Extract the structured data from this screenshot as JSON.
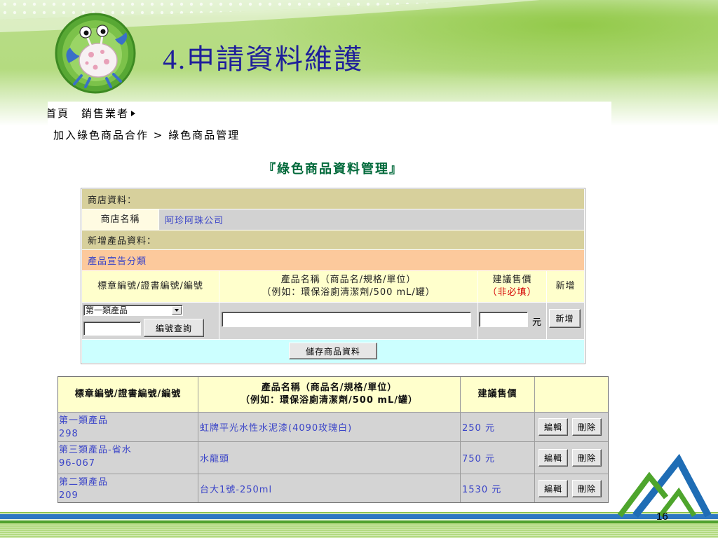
{
  "slide": {
    "title": "4.申請資料維護",
    "page_number": "16"
  },
  "web": {
    "breadcrumb": {
      "top": "首頁　銷售業者",
      "path": "加入綠色商品合作 > 綠色商品管理"
    },
    "heading": "『綠色商品資料管理』",
    "store": {
      "section_label": "商店資料：",
      "name_label": "商店名稱",
      "name_value": "阿珍阿珠公司"
    },
    "new_product": {
      "section_label": "新增產品資料：",
      "category_link": "產品宣告分類",
      "headers": {
        "code": "標章編號/證書編號/編號",
        "name_line1": "產品名稱（商品名/規格/單位）",
        "name_line2": "（例如：環保浴廁清潔劑/500 mL/罐）",
        "price_line1": "建議售價",
        "price_line2": "（非必填）",
        "add": "新增"
      },
      "category_select": "第一類產品",
      "code_input": "",
      "search_button": "編號查詢",
      "name_input": "",
      "price_input": "",
      "price_unit": "元",
      "add_button": "新增",
      "save_button": "儲存商品資料"
    },
    "product_list": {
      "headers": {
        "code": "標章編號/證書編號/編號",
        "name_line1": "產品名稱（商品名/規格/單位）",
        "name_line2": "（例如：環保浴廁清潔劑/500 mL/罐）",
        "price": "建議售價"
      },
      "rows": [
        {
          "category": "第一類產品",
          "code": "298",
          "name": "虹牌平光水性水泥漆(4090玫瑰白)",
          "price": "250 元",
          "edit": "編輯",
          "delete": "刪除"
        },
        {
          "category": "第三類產品-省水",
          "code": "96-067",
          "name": "水龍頭",
          "price": "750 元",
          "edit": "編輯",
          "delete": "刪除"
        },
        {
          "category": "第二類產品",
          "code": "209",
          "name": "台大1號-250ml",
          "price": "1530 元",
          "edit": "編輯",
          "delete": "刪除"
        }
      ]
    }
  },
  "colors": {
    "title": "#1f1f9a",
    "heading": "#00693a",
    "link_text": "#3a44c8",
    "required_note": "#d40000",
    "khaki_row": "#d7d09c",
    "category_row": "#fcc99c",
    "header_cell": "#ffffcc",
    "input_row": "#d4d4d4",
    "save_row": "#ccffff"
  },
  "icons": {
    "logo": "crab-mascot-logo",
    "breadcrumb_arrow": "arrow-right-icon",
    "select_dropdown": "chevron-down-icon",
    "footer_logo": "mountain-logo"
  }
}
